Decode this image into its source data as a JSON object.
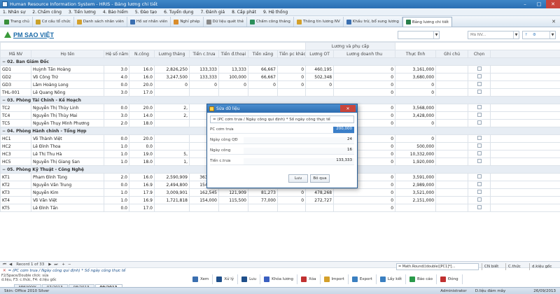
{
  "app": {
    "title": "Human Resource Information System - HRIS - Bảng lương chi tiết"
  },
  "menu": [
    "1. Nhân sự",
    "2. Chấm công",
    "3. Tiền lương",
    "4. Bảo hiểm",
    "5. Đào tạo",
    "6. Tuyển dụng",
    "7. Đánh giá",
    "8. Cấp phát",
    "9. Hệ thống"
  ],
  "tabs": [
    {
      "label": "Trang chủ",
      "color": "#3a8f3a"
    },
    {
      "label": "Cơ cấu tổ chức",
      "color": "#c9a12a"
    },
    {
      "label": "Danh sách nhân viên",
      "color": "#d4a02a"
    },
    {
      "label": "Hồ sơ nhân viên",
      "color": "#3a6fb0"
    },
    {
      "label": "Nghỉ phép",
      "color": "#d98c2a"
    },
    {
      "label": "Dữ liệu quét thẻ",
      "color": "#8a8a8a"
    },
    {
      "label": "Chấm công tháng",
      "color": "#2a8f5a"
    },
    {
      "label": "Thông tin lương NV",
      "color": "#d4a02a"
    },
    {
      "label": "Khấu trừ, bổ sung lương",
      "color": "#3a6fb0"
    },
    {
      "label": "Bảng lương chi tiết",
      "color": "#2a7f4a"
    }
  ],
  "form": {
    "title": "PM SAO VIỆT"
  },
  "combos": {
    "first": "",
    "second": "Mã NV..."
  },
  "grid": {
    "group_header": "Lương và phụ cấp",
    "columns": [
      "Mã NV",
      "Họ tên",
      "Hệ số năm",
      "N.công",
      "Lương tháng",
      "Tiền c.trưa",
      "Tiền đ.thoại",
      "Tiền xăng",
      "Tiền pc khác",
      "Lương OT",
      "Lương doanh thu",
      "Thực lĩnh",
      "Ghi chú",
      "Chọn"
    ],
    "rows": [
      {
        "type": "group",
        "label": "02. Ban Giám Đốc"
      },
      {
        "type": "row",
        "cells": [
          "GD1",
          "Huỳnh Tấn Hoàng",
          "3.0",
          "16.0",
          "2,826,250",
          "133,333",
          "13,333",
          "66,667",
          "0",
          "460,195",
          "0",
          "3,161,000",
          ""
        ]
      },
      {
        "type": "row",
        "cells": [
          "GD2",
          "Võ Công Trứ",
          "4.0",
          "16.0",
          "3,247,500",
          "133,333",
          "100,000",
          "66,667",
          "0",
          "502,348",
          "0",
          "3,680,000",
          ""
        ]
      },
      {
        "type": "row",
        "cells": [
          "GD3",
          "Lâm Hoàng Long",
          "0.0",
          "20.0",
          "0",
          "0",
          "0",
          "0",
          "0",
          "0",
          "0",
          "0",
          ""
        ]
      },
      {
        "type": "row",
        "cells": [
          "THL-001",
          "Lê Quang Nông",
          "3.0",
          "17.0",
          "",
          "",
          "",
          "",
          "",
          "",
          "0",
          "0",
          ""
        ]
      },
      {
        "type": "group",
        "label": "03. Phòng Tài Chính - Kế Hoạch"
      },
      {
        "type": "row",
        "cells": [
          "TC2",
          "Nguyễn Thị Thùy Linh",
          "0.0",
          "20.0",
          "2,",
          "",
          "",
          "",
          "",
          "417,656",
          "0",
          "3,568,000",
          ""
        ]
      },
      {
        "type": "row",
        "cells": [
          "TC4",
          "Nguyễn Thị Thùy Mai",
          "3.0",
          "14.0",
          "2,",
          "",
          "",
          "",
          "",
          "450,693",
          "0",
          "3,428,000",
          ""
        ]
      },
      {
        "type": "row",
        "cells": [
          "TC5",
          "Nguyễn Thụy Minh Phương",
          "2.0",
          "18.0",
          "",
          "",
          "",
          "",
          "",
          "0",
          "0",
          "0",
          ""
        ]
      },
      {
        "type": "group",
        "label": "04. Phòng Hành chính - Tổng Hợp"
      },
      {
        "type": "row",
        "cells": [
          "HC1",
          "Võ Thành Việt",
          "0.0",
          "20.0",
          "",
          "",
          "",
          "",
          "",
          "0",
          "0",
          "0",
          ""
        ]
      },
      {
        "type": "row",
        "cells": [
          "HC2",
          "Lê Đình Thoa",
          "1.0",
          "0.0",
          "",
          "",
          "",
          "",
          "",
          "0",
          "0",
          "500,000",
          ""
        ]
      },
      {
        "type": "row",
        "cells": [
          "HC3",
          "Lê Thị Thu Hà",
          "1.0",
          "19.0",
          "5,",
          "",
          "",
          "",
          "",
          "773,438",
          "0",
          "10,332,000",
          ""
        ]
      },
      {
        "type": "row",
        "cells": [
          "HC5",
          "Nguyễn Thị Giang San",
          "1.0",
          "18.0",
          "1,",
          "",
          "",
          "",
          "",
          "232,031",
          "0",
          "1,920,000",
          ""
        ]
      },
      {
        "type": "group",
        "label": "05. Phòng Kỹ Thuật - Công Nghệ"
      },
      {
        "type": "row",
        "cells": [
          "KT1",
          "Phạm Đình Tùng",
          "2.0",
          "16.0",
          "2,590,909",
          "363,636",
          "181,818",
          "218,182",
          "100,000",
          "421,875",
          "0",
          "3,591,000",
          ""
        ]
      },
      {
        "type": "row",
        "cells": [
          "KT2",
          "Nguyễn Văn Trung",
          "0.0",
          "16.9",
          "2,494,800",
          "154,000",
          "115,500",
          "77,000",
          "0",
          "455,625",
          "0",
          "2,989,000",
          ""
        ]
      },
      {
        "type": "row",
        "cells": [
          "KT3",
          "Nguyễn Kim",
          "1.0",
          "17.9",
          "3,009,901",
          "162,545",
          "121,909",
          "81,273",
          "0",
          "478,268",
          "0",
          "3,521,000",
          ""
        ]
      },
      {
        "type": "row",
        "cells": [
          "KT4",
          "Võ Văn Việt",
          "1.0",
          "16.9",
          "1,721,818",
          "154,000",
          "115,500",
          "77,000",
          "0",
          "272,727",
          "0",
          "2,151,000",
          ""
        ]
      },
      {
        "type": "row",
        "cells": [
          "KT5",
          "Lê Đình Tấn",
          "0.0",
          "17.0",
          "",
          "",
          "",
          "",
          "",
          "",
          "0",
          "",
          ""
        ]
      }
    ]
  },
  "nav": {
    "record": "Record 1 of 33"
  },
  "filter": {
    "text": "= (PC cơm trưa / Ngày công qui định) * Số ngày công thực tế"
  },
  "formula_bar": {
    "value": "= Math.Round((double)[PC1]*[..."
  },
  "formula_buttons": [
    "CN biết",
    "C.thức",
    "d.kiệu gốc"
  ],
  "hint": {
    "line1": "F2/Space/Double click: sửa",
    "line2": "d.liệu, F3: c.thức, F4: d.liệu gốc"
  },
  "toolbar": [
    {
      "label": "Xem",
      "color": "#3a6fb0"
    },
    {
      "label": "Xử lý",
      "color": "#1f4f8a"
    },
    {
      "label": "Lưu",
      "color": "#1f4f8a"
    },
    {
      "label": "Khóa lương",
      "color": "#3a5fc0"
    },
    {
      "label": "Xóa",
      "color": "#c03030"
    },
    {
      "label": "Import",
      "color": "#d4a02a"
    },
    {
      "label": "Export",
      "color": "#3a7fc0"
    },
    {
      "label": "Lấy kết",
      "color": "#3a7fc0"
    },
    {
      "label": "Báo cáo",
      "color": "#2a9a4a"
    },
    {
      "label": "Đóng",
      "color": "#c03030"
    }
  ],
  "month_tabs": [
    "MM/YYYY",
    "07/2013",
    "08/2013",
    "09/2013"
  ],
  "status": {
    "left": "Skin: Office 2010 Silver",
    "user": "Administrator",
    "db": "D.liệu đám mây",
    "date": "26/09/2013"
  },
  "dialog": {
    "title": "Sửa dữ liệu",
    "formula": "= (PC cơm trưa / Ngày công qui định) * Số ngày công thực tế",
    "fields": [
      {
        "label": "PC cơm trưa",
        "value": "200,000"
      },
      {
        "label": "Ngày công QĐ",
        "value": "24"
      },
      {
        "label": "Ngày công",
        "value": "16"
      },
      {
        "label": "Tiền c.trưa",
        "value": "133,333"
      }
    ],
    "save": "Lưu",
    "cancel": "Bỏ qua"
  }
}
